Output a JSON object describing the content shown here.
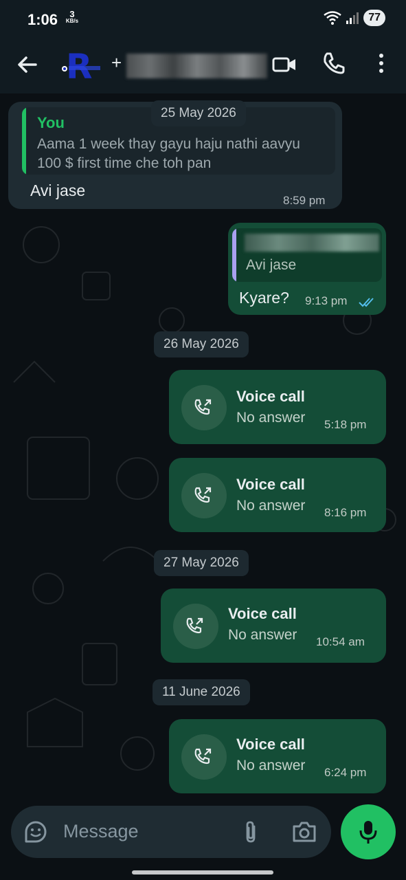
{
  "status_bar": {
    "time": "1:06",
    "net_speed_value": "3",
    "net_speed_unit": "KB/s",
    "battery": "77"
  },
  "header": {
    "contact_prefix": "+",
    "icons": [
      "back-arrow-icon",
      "video-call-icon",
      "phone-icon",
      "more-vert-icon"
    ]
  },
  "messages": [
    {
      "date": "25 May 2026",
      "incoming": {
        "quote_author": "You",
        "quote_text_line1": "Aama 1 week thay gayu haju nathi aavyu",
        "quote_text_line2": "100 $ first time che toh pan",
        "text": "Avi jase",
        "time": "8:59 pm"
      },
      "outgoing": {
        "quote_text": "Avi jase",
        "text": "Kyare?",
        "time": "9:13 pm",
        "status": "read"
      }
    }
  ],
  "calls": [
    {
      "date": "26 May 2026",
      "title": "Voice call",
      "subtitle": "No answer",
      "time": "5:18 pm"
    },
    {
      "date": "",
      "title": "Voice call",
      "subtitle": "No answer",
      "time": "8:16 pm"
    },
    {
      "date": "27 May 2026",
      "title": "Voice call",
      "subtitle": "No answer",
      "time": "10:54 am"
    },
    {
      "date": "11 June 2026",
      "title": "Voice call",
      "subtitle": "No answer",
      "time": "6:24 pm"
    }
  ],
  "input": {
    "placeholder": "Message"
  },
  "colors": {
    "outgoing_bubble": "#144d37",
    "incoming_bubble": "#1f2c33",
    "accent_green": "#21c063",
    "read_ticks": "#53bdeb"
  }
}
